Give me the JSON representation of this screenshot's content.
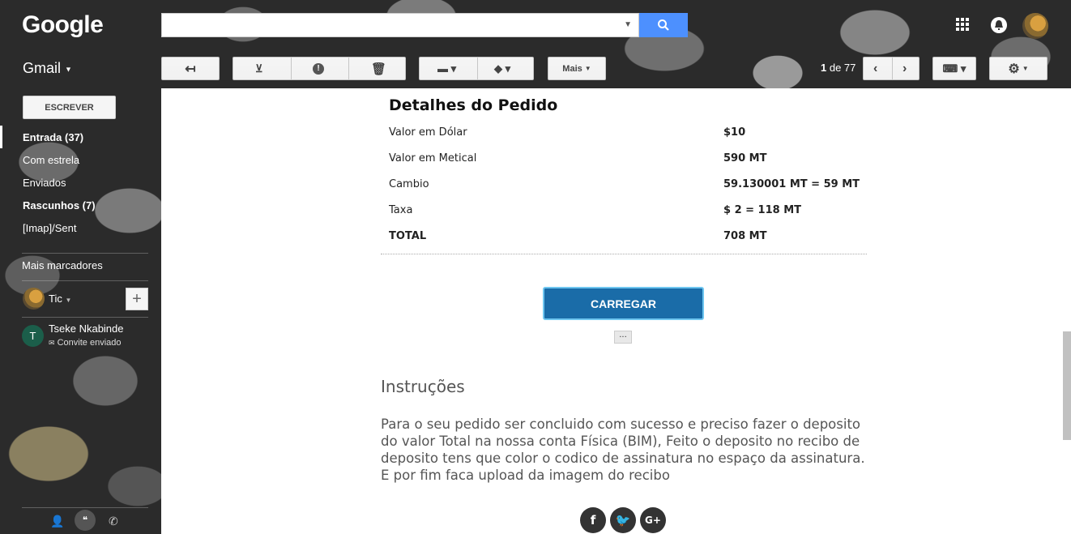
{
  "header": {
    "logo": "Google",
    "search_value": "",
    "search_placeholder": ""
  },
  "toolbar": {
    "gmail_label": "Gmail",
    "more_label": "Mais",
    "pager_prefix": "1",
    "pager_text": "de 77"
  },
  "sidebar": {
    "compose": "ESCREVER",
    "items": [
      {
        "label": "Entrada (37)"
      },
      {
        "label": "Com estrela"
      },
      {
        "label": "Enviados"
      },
      {
        "label": "Rascunhos (7)"
      },
      {
        "label": "[Imap]/Sent"
      }
    ],
    "more_labels": "Mais marcadores",
    "hangouts_user": "Tic",
    "contact": {
      "initial": "T",
      "name": "Tseke Nkabinde",
      "status": "Convite enviado"
    }
  },
  "email": {
    "details_title": "Detalhes do Pedido",
    "rows": [
      {
        "label": "Valor em Dólar",
        "value": "$10"
      },
      {
        "label": "Valor em Metical",
        "value": "590 MT"
      },
      {
        "label": "Cambio",
        "value": "59.130001 MT = 59 MT"
      },
      {
        "label": "Taxa",
        "value": "$ 2 = 118 MT"
      },
      {
        "label": "TOTAL",
        "value": "708 MT"
      }
    ],
    "cta": "CARREGAR",
    "ellipsis": "···",
    "instructions_title": "Instruções",
    "instructions_text": "Para o seu pedido ser concluido com sucesso e preciso fazer o deposito do valor Total na nossa conta Física (BIM), Feito o deposito no recibo de deposito tens que color o codico de assinatura no espaço da assinatura. E por fim faca upload da imagem do recibo",
    "social": [
      "facebook-icon",
      "twitter-icon",
      "google-plus-icon"
    ]
  },
  "colors": {
    "cta": "#1a6ca8",
    "search_button": "#4d90fe"
  }
}
